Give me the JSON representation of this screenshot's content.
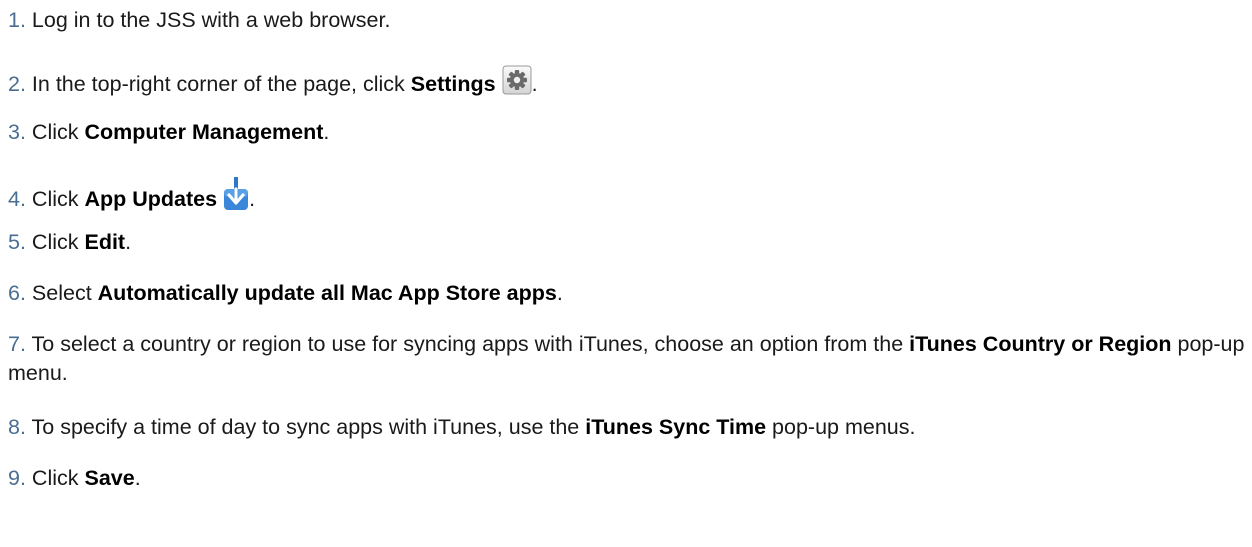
{
  "steps": [
    {
      "num": "1.",
      "text1": "Log in to the JSS with a web browser."
    },
    {
      "num": "2.",
      "text1": "In the top-right corner of the page, click ",
      "bold1": "Settings",
      "text2": "."
    },
    {
      "num": "3.",
      "text1": "Click ",
      "bold1": "Computer Management",
      "text2": "."
    },
    {
      "num": "4.",
      "text1": "Click ",
      "bold1": "App Updates",
      "text2": "."
    },
    {
      "num": "5.",
      "text1": "Click ",
      "bold1": "Edit",
      "text2": "."
    },
    {
      "num": "6.",
      "text1": "Select ",
      "bold1": "Automatically update all Mac App Store apps",
      "text2": "."
    },
    {
      "num": "7.",
      "text1": "To select a country or region to use for syncing apps with iTunes, choose an option from the ",
      "bold1": "iTunes Country or Region",
      "text2": " pop-up menu."
    },
    {
      "num": "8.",
      "text1": "To specify a time of day to sync apps with iTunes, use the ",
      "bold1": "iTunes Sync Time",
      "text2": " pop-up menus."
    },
    {
      "num": "9.",
      "text1": "Click ",
      "bold1": "Save",
      "text2": "."
    }
  ],
  "icons": {
    "settings": "gear-icon",
    "app_updates": "download-arrow-icon"
  },
  "colors": {
    "step_number": "#4a6e93",
    "text": "#1a1a1a",
    "update_icon": "#3a86d9"
  }
}
